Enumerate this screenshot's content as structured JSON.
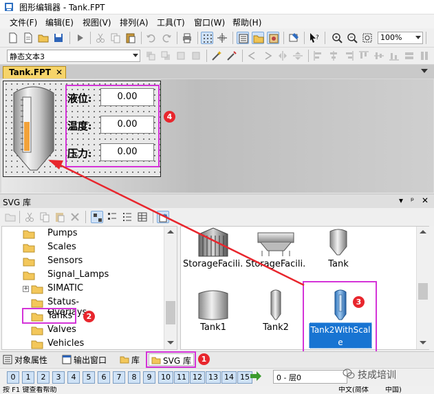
{
  "window": {
    "title": "图形编辑器 - Tank.FPT"
  },
  "menu": {
    "items": [
      "文件(F)",
      "编辑(E)",
      "视图(V)",
      "排列(A)",
      "工具(T)",
      "窗口(W)",
      "帮助(H)"
    ]
  },
  "toolbar": {
    "zoom": "100%"
  },
  "toolbar2": {
    "object_selector": "静态文本3"
  },
  "doc_tab": {
    "label": "Tank.FPT",
    "close": "✕"
  },
  "design": {
    "fields": [
      {
        "label": "液位:",
        "value": "0.00"
      },
      {
        "label": "温度:",
        "value": "0.00"
      },
      {
        "label": "压力:",
        "value": "0.00"
      }
    ]
  },
  "svg_panel": {
    "title": "SVG 库",
    "header_controls": [
      "▾",
      "ᵖ",
      "✕"
    ],
    "tree": [
      {
        "label": "Pumps",
        "expandable": false
      },
      {
        "label": "Scales",
        "expandable": false
      },
      {
        "label": "Sensors",
        "expandable": false
      },
      {
        "label": "Signal_Lamps",
        "expandable": false
      },
      {
        "label": "SIMATIC",
        "expandable": true
      },
      {
        "label": "Status-Overlays",
        "expandable": false
      },
      {
        "label": "Tanks",
        "expandable": false
      },
      {
        "label": "Valves",
        "expandable": false
      },
      {
        "label": "Vehicles",
        "expandable": false
      }
    ],
    "grid": [
      {
        "label": "StorageFacili...",
        "icon": "storage-silo-icon"
      },
      {
        "label": "StorageFacili...",
        "icon": "storage-hopper-icon"
      },
      {
        "label": "Tank",
        "icon": "tank-funnel-icon"
      },
      {
        "label": "Tank1",
        "icon": "tank-cylinder-icon"
      },
      {
        "label": "Tank2",
        "icon": "tank-tall-icon"
      }
    ],
    "selected": {
      "line1": "Tank2WithScal",
      "line2": "e"
    }
  },
  "panel_tabs": [
    "对象属性",
    "输出窗口",
    "库",
    "SVG 库"
  ],
  "layers": {
    "numbers": [
      "0",
      "1",
      "2",
      "3",
      "4",
      "5",
      "6",
      "7",
      "8",
      "9",
      "10",
      "11",
      "12",
      "13",
      "14",
      "15"
    ],
    "current": "0 - 层0"
  },
  "watermark": {
    "text": "技成培训"
  },
  "annotations": [
    "1",
    "2",
    "3",
    "4"
  ],
  "status": {
    "help": "按 F1 键查看帮助",
    "ime": "中文(简体",
    "region": "中国)"
  },
  "colors": {
    "highlight": "#d433d8",
    "badge": "#e8262d",
    "selection": "#1874d2",
    "arrow": "#e8262d",
    "tab_active": "#f6d46a"
  }
}
